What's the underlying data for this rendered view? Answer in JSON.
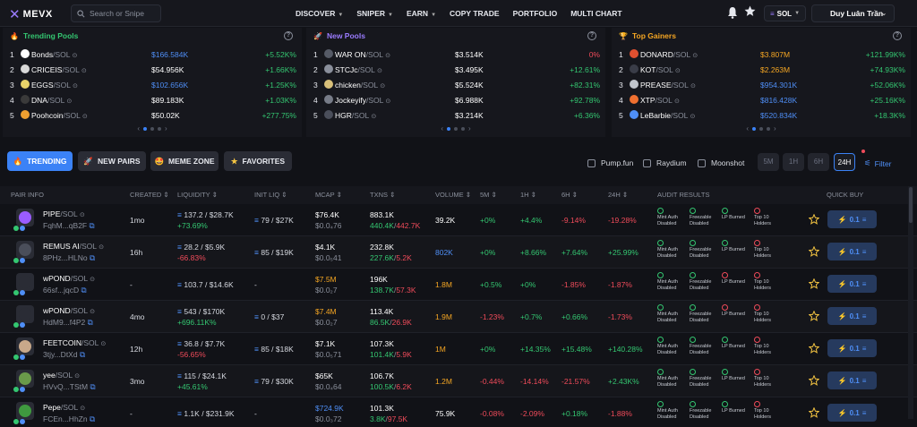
{
  "app": {
    "logo_text": "MEVX",
    "accent": "#9b7cff"
  },
  "search": {
    "placeholder": "Search or Snipe"
  },
  "nav": {
    "items": [
      "DISCOVER",
      "SNIPER",
      "EARN",
      "COPY TRADE",
      "PORTFOLIO",
      "MULTI CHART"
    ],
    "with_caret": [
      true,
      true,
      true,
      false,
      false,
      false
    ]
  },
  "chain": {
    "label": "SOL"
  },
  "user": {
    "name": "Duy Luân Trần"
  },
  "panels": [
    {
      "title": "Trending Pools",
      "icon": "fire-icon",
      "title_color": "#34c771",
      "rows": [
        {
          "n": "1",
          "name": "Bonds",
          "pair": "/SOL",
          "price": "$166.584K",
          "price_color": "blue",
          "change": "+5.52K%",
          "change_color": "green",
          "token_color": "#ffffff"
        },
        {
          "n": "2",
          "name": "CRICEIS",
          "pair": "/SOL",
          "price": "$54.956K",
          "price_color": "white",
          "change": "+1.66K%",
          "change_color": "green",
          "token_color": "#d9d9d9"
        },
        {
          "n": "3",
          "name": "EGGS",
          "pair": "/SOL",
          "price": "$102.656K",
          "price_color": "blue",
          "change": "+1.25K%",
          "change_color": "green",
          "token_color": "#e8d36a"
        },
        {
          "n": "4",
          "name": "DNA",
          "pair": "/SOL",
          "price": "$89.183K",
          "price_color": "white",
          "change": "+1.03K%",
          "change_color": "green",
          "token_color": "#3a3a3a"
        },
        {
          "n": "5",
          "name": "Poohcoin",
          "pair": "/SOL",
          "price": "$50.02K",
          "price_color": "white",
          "change": "+277.75%",
          "change_color": "green",
          "token_color": "#f0a030"
        }
      ]
    },
    {
      "title": "New Pools",
      "icon": "rocket-icon",
      "title_color": "#9b7cff",
      "rows": [
        {
          "n": "1",
          "name": "WAR ON",
          "pair": "/SOL",
          "price": "$3.514K",
          "price_color": "white",
          "change": "0%",
          "change_color": "red",
          "token_color": "#555a66"
        },
        {
          "n": "2",
          "name": "STCJc",
          "pair": "/SOL",
          "price": "$3.495K",
          "price_color": "white",
          "change": "+12.61%",
          "change_color": "green",
          "token_color": "#8a8f9b"
        },
        {
          "n": "3",
          "name": "chicken",
          "pair": "/SOL",
          "price": "$5.524K",
          "price_color": "white",
          "change": "+82.31%",
          "change_color": "green",
          "token_color": "#d8c07a"
        },
        {
          "n": "4",
          "name": "Jockeyify",
          "pair": "/SOL",
          "price": "$6.988K",
          "price_color": "white",
          "change": "+92.78%",
          "change_color": "green",
          "token_color": "#777c88"
        },
        {
          "n": "5",
          "name": "HGR",
          "pair": "/SOL",
          "price": "$3.214K",
          "price_color": "white",
          "change": "+6.36%",
          "change_color": "green",
          "token_color": "#4a4e5a"
        }
      ]
    },
    {
      "title": "Top Gainers",
      "icon": "trophy-icon",
      "title_color": "#f5a623",
      "rows": [
        {
          "n": "1",
          "name": "DONARD",
          "pair": "/SOL",
          "price": "$3.807M",
          "price_color": "orange",
          "change": "+121.99K%",
          "change_color": "green",
          "token_color": "#e05030"
        },
        {
          "n": "2",
          "name": "KOT",
          "pair": "/SOL",
          "price": "$2.263M",
          "price_color": "orange",
          "change": "+74.93K%",
          "change_color": "green",
          "token_color": "#3a3d48"
        },
        {
          "n": "3",
          "name": "PREASE",
          "pair": "/SOL",
          "price": "$954.301K",
          "price_color": "blue",
          "change": "+52.06K%",
          "change_color": "green",
          "token_color": "#c0c4cc"
        },
        {
          "n": "4",
          "name": "XTP",
          "pair": "/SOL",
          "price": "$816.428K",
          "price_color": "blue",
          "change": "+25.16K%",
          "change_color": "green",
          "token_color": "#f07030"
        },
        {
          "n": "5",
          "name": "LeBarbie",
          "pair": "/SOL",
          "price": "$520.834K",
          "price_color": "blue",
          "change": "+18.3K%",
          "change_color": "green",
          "token_color": "#4f8ff7"
        }
      ]
    }
  ],
  "filters": {
    "tabs": [
      "TRENDING",
      "NEW PAIRS",
      "MEME ZONE",
      "FAVORITES"
    ],
    "checks": [
      "Pump.fun",
      "Raydium",
      "Moonshot"
    ],
    "timeframes": [
      "5M",
      "1H",
      "6H",
      "24H"
    ],
    "active_timeframe": "24H",
    "filter_label": "Filter"
  },
  "table": {
    "headers": [
      "PAIR INFO",
      "CREATED",
      "LIQUIDITY",
      "INIT LIQ",
      "MCAP",
      "TXNS",
      "VOLUME",
      "5M",
      "1H",
      "6H",
      "24H",
      "AUDIT RESULTS",
      "QUICK BUY"
    ],
    "audit_labels": [
      "Mint Auth Disabled",
      "Freezable Disabled",
      "LP Burned",
      "Top 10 Holders"
    ],
    "quick_buy_label": "0.1",
    "rows": [
      {
        "name": "PIPE",
        "pair": "/SOL",
        "addr": "FqhM...qB2F",
        "created": "1mo",
        "liq": "137.2 / $28.7K",
        "liq_change": "+73.69%",
        "liq_change_color": "green",
        "init_liq": "79 / $27K",
        "mcap": "$76.4K",
        "mcap_color": "white",
        "mcap_sub": "$0.0₄76",
        "txns": "883.1K",
        "buys": "440.4K",
        "sells": "442.7K",
        "volume": "39.2K",
        "volume_color": "white",
        "m5": "+0%",
        "m5c": "green",
        "h1": "+4.4%",
        "h1c": "green",
        "h6": "-9.14%",
        "h6c": "red",
        "h24": "-19.28%",
        "h24c": "red",
        "audit": [
          true,
          true,
          true,
          false
        ],
        "avatar_color": "#9b5cff"
      },
      {
        "name": "REMUS AI",
        "pair": "/SOL",
        "addr": "8PHz...HLNo",
        "created": "16h",
        "liq": "28.2 / $5.9K",
        "liq_change": "-66.83%",
        "liq_change_color": "red",
        "init_liq": "85 / $19K",
        "mcap": "$4.1K",
        "mcap_color": "white",
        "mcap_sub": "$0.0₅41",
        "txns": "232.8K",
        "buys": "227.6K",
        "sells": "5.2K",
        "volume": "802K",
        "volume_color": "blue",
        "m5": "+0%",
        "m5c": "green",
        "h1": "+8.66%",
        "h1c": "green",
        "h6": "+7.64%",
        "h6c": "green",
        "h24": "+25.99%",
        "h24c": "green",
        "audit": [
          true,
          true,
          true,
          false
        ],
        "avatar_color": "#4a4e5a"
      },
      {
        "name": "wPOND",
        "pair": "/SOL",
        "addr": "66sf...jqcD",
        "created": "-",
        "liq": "103.7 / $14.6K",
        "liq_change": "",
        "liq_change_color": "green",
        "init_liq": "-",
        "mcap": "$7.5M",
        "mcap_color": "orange",
        "mcap_sub": "$0.0₂7",
        "txns": "196K",
        "buys": "138.7K",
        "sells": "57.3K",
        "volume": "1.8M",
        "volume_color": "orange",
        "m5": "+0.5%",
        "m5c": "green",
        "h1": "+0%",
        "h1c": "green",
        "h6": "-1.85%",
        "h6c": "red",
        "h24": "-1.87%",
        "h24c": "red",
        "audit": [
          true,
          true,
          false,
          false
        ],
        "avatar_color": "#2a2c35"
      },
      {
        "name": "wPOND",
        "pair": "/SOL",
        "addr": "HdM9...f4P2",
        "created": "4mo",
        "liq": "543 / $170K",
        "liq_change": "+696.11K%",
        "liq_change_color": "green",
        "init_liq": "0 / $37",
        "mcap": "$7.4M",
        "mcap_color": "orange",
        "mcap_sub": "$0.0₂7",
        "txns": "113.4K",
        "buys": "86.5K",
        "sells": "26.9K",
        "volume": "1.9M",
        "volume_color": "orange",
        "m5": "-1.23%",
        "m5c": "red",
        "h1": "+0.7%",
        "h1c": "green",
        "h6": "+0.66%",
        "h6c": "green",
        "h24": "-1.73%",
        "h24c": "red",
        "audit": [
          true,
          true,
          false,
          false
        ],
        "avatar_color": "#2a2c35"
      },
      {
        "name": "FEETCOIN",
        "pair": "/SOL",
        "addr": "3tjy...DtXd",
        "created": "12h",
        "liq": "36.8 / $7.7K",
        "liq_change": "-56.65%",
        "liq_change_color": "red",
        "init_liq": "85 / $18K",
        "mcap": "$7.1K",
        "mcap_color": "white",
        "mcap_sub": "$0.0₅71",
        "txns": "107.3K",
        "buys": "101.4K",
        "sells": "5.9K",
        "volume": "1M",
        "volume_color": "orange",
        "m5": "+0%",
        "m5c": "green",
        "h1": "+14.35%",
        "h1c": "green",
        "h6": "+15.48%",
        "h6c": "green",
        "h24": "+140.28%",
        "h24c": "green",
        "audit": [
          true,
          true,
          true,
          false
        ],
        "avatar_color": "#c8a88a"
      },
      {
        "name": "yee",
        "pair": "/SOL",
        "addr": "HVvQ...TStM",
        "created": "3mo",
        "liq": "115 / $24.1K",
        "liq_change": "+45.61%",
        "liq_change_color": "green",
        "init_liq": "79 / $30K",
        "mcap": "$65K",
        "mcap_color": "white",
        "mcap_sub": "$0.0₄64",
        "txns": "106.7K",
        "buys": "100.5K",
        "sells": "6.2K",
        "volume": "1.2M",
        "volume_color": "orange",
        "m5": "-0.44%",
        "m5c": "red",
        "h1": "-14.14%",
        "h1c": "red",
        "h6": "-21.57%",
        "h6c": "red",
        "h24": "+2.43K%",
        "h24c": "green",
        "audit": [
          true,
          true,
          true,
          false
        ],
        "avatar_color": "#6a9a4a"
      },
      {
        "name": "Pepe",
        "pair": "/SOL",
        "addr": "FCEn...HhZn",
        "created": "-",
        "liq": "1.1K / $231.9K",
        "liq_change": "",
        "liq_change_color": "green",
        "init_liq": "-",
        "mcap": "$724.9K",
        "mcap_color": "blue",
        "mcap_sub": "$0.0₃72",
        "txns": "101.3K",
        "buys": "3.8K",
        "sells": "97.5K",
        "volume": "75.9K",
        "volume_color": "white",
        "m5": "-0.08%",
        "m5c": "red",
        "h1": "-2.09%",
        "h1c": "red",
        "h6": "+0.18%",
        "h6c": "green",
        "h24": "-1.88%",
        "h24c": "red",
        "audit": [
          true,
          true,
          true,
          false
        ],
        "avatar_color": "#3f9a3f"
      }
    ]
  }
}
